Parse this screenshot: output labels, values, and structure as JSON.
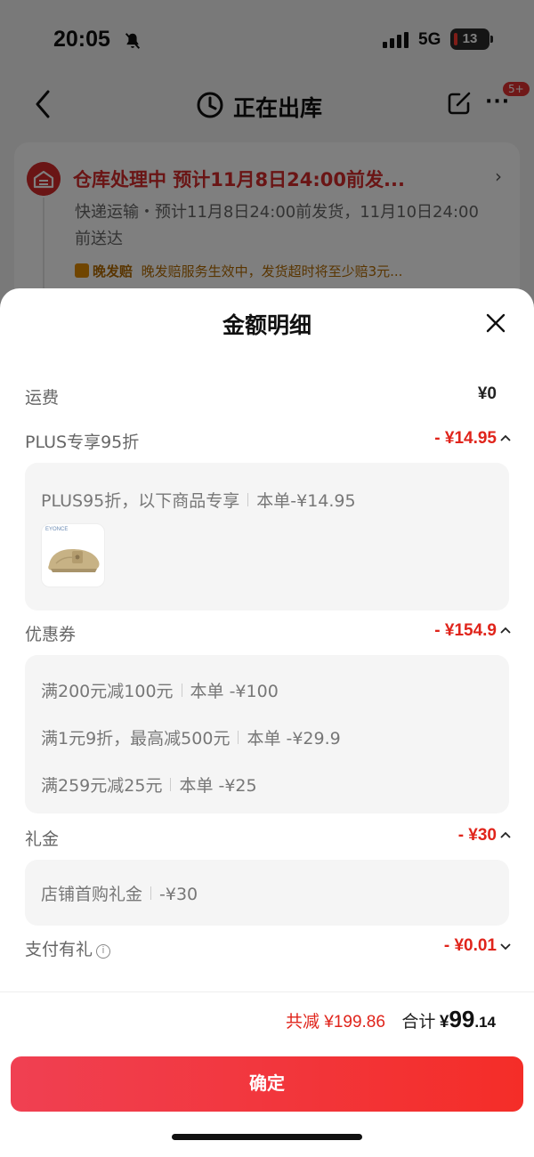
{
  "status_bar": {
    "time": "20:05",
    "network": "5G",
    "battery": "13"
  },
  "nav": {
    "title": "正在出库",
    "badge": "5+",
    "more_glyph": "···"
  },
  "status_card": {
    "title": "仓库处理中  预计11月8日24:00前发...",
    "description": "快递运输・预计11月8日24:00前发货，11月10日24:00前送达",
    "guarantee_tag": "晚发赔",
    "guarantee_text": "晚发赔服务生效中，发货超时将至少赔3元...",
    "chevron": "›"
  },
  "sheet": {
    "title": "金额明细",
    "shipping": {
      "label": "运费",
      "value": "¥0"
    },
    "plus": {
      "label": "PLUS专享95折",
      "value": "- ¥14.95",
      "detail": {
        "text": "PLUS95折，以下商品专享",
        "amount": "本单-¥14.95"
      },
      "product_brand": "EYONCE"
    },
    "coupon": {
      "label": "优惠券",
      "value": "- ¥154.9",
      "items": [
        {
          "text": "满200元减100元",
          "amount": "本单 -¥100"
        },
        {
          "text": "满1元9折，最高减500元",
          "amount": "本单 -¥29.9"
        },
        {
          "text": "满259元减25元",
          "amount": "本单 -¥25"
        }
      ]
    },
    "gift": {
      "label": "礼金",
      "value": "- ¥30",
      "detail": {
        "text": "店铺首购礼金",
        "amount": "-¥30"
      }
    },
    "pay_gift": {
      "label": "支付有礼",
      "value": "- ¥0.01",
      "info_glyph": "i"
    }
  },
  "footer": {
    "saved": "共减 ¥199.86",
    "total_label": "合计",
    "total_yen": "¥",
    "total_int": "99",
    "total_dec": ".14",
    "confirm": "确定"
  },
  "colors": {
    "accent_red": "#e0241b",
    "button_start": "#f04052",
    "button_end": "#f42d28"
  }
}
